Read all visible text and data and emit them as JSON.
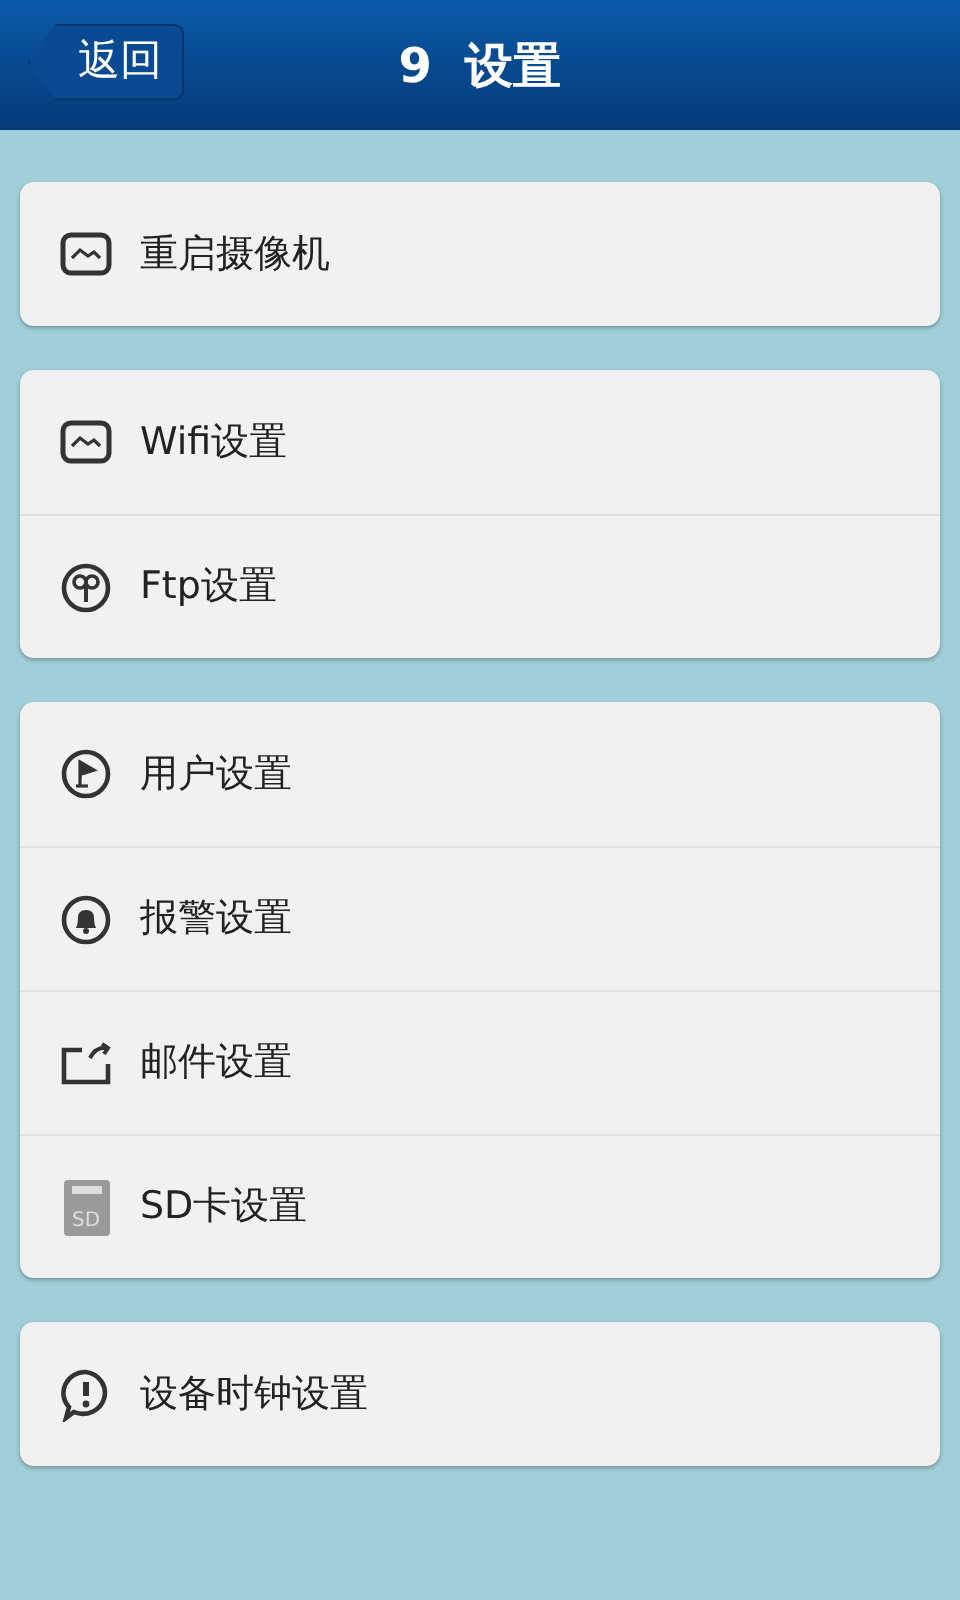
{
  "header": {
    "back": "返回",
    "title": "9  设置"
  },
  "groups": [
    {
      "items": [
        {
          "label": "重启摄像机",
          "kind": "wave"
        }
      ]
    },
    {
      "items": [
        {
          "label": "Wifi设置",
          "kind": "wave"
        },
        {
          "label": "Ftp设置",
          "kind": "ftp"
        }
      ]
    },
    {
      "items": [
        {
          "label": "用户设置",
          "kind": "flag"
        },
        {
          "label": "报警设置",
          "kind": "bell"
        },
        {
          "label": "邮件设置",
          "kind": "share"
        },
        {
          "label": "SD卡设置",
          "kind": "sd",
          "icon_label": "SD"
        }
      ]
    },
    {
      "items": [
        {
          "label": "设备时钟设置",
          "kind": "alert"
        }
      ]
    }
  ]
}
